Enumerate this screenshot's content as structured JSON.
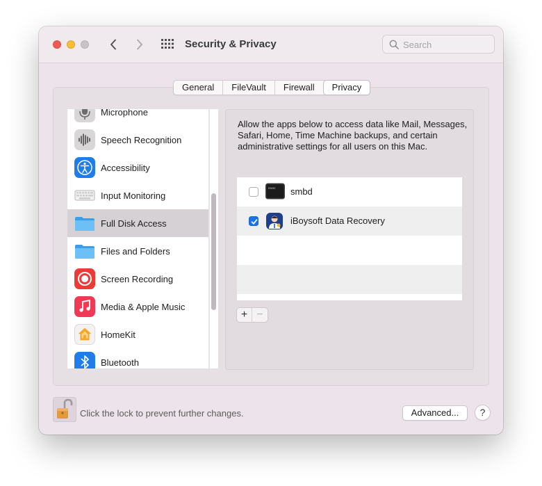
{
  "window": {
    "title": "Security & Privacy",
    "search": {
      "placeholder": "Search",
      "value": ""
    }
  },
  "tabs": [
    {
      "label": "General"
    },
    {
      "label": "FileVault"
    },
    {
      "label": "Firewall"
    },
    {
      "label": "Privacy",
      "active": true
    }
  ],
  "privacy_list": [
    {
      "label": "Microphone",
      "icon": "microphone-icon"
    },
    {
      "label": "Speech Recognition",
      "icon": "waveform-icon"
    },
    {
      "label": "Accessibility",
      "icon": "accessibility-icon"
    },
    {
      "label": "Input Monitoring",
      "icon": "keyboard-icon"
    },
    {
      "label": "Full Disk Access",
      "icon": "folder-icon",
      "selected": true
    },
    {
      "label": "Files and Folders",
      "icon": "folder-icon"
    },
    {
      "label": "Screen Recording",
      "icon": "record-icon"
    },
    {
      "label": "Media & Apple Music",
      "icon": "music-icon"
    },
    {
      "label": "HomeKit",
      "icon": "home-icon"
    },
    {
      "label": "Bluetooth",
      "icon": "bluetooth-icon"
    }
  ],
  "detail": {
    "description": "Allow the apps below to access data like Mail, Messages, Safari, Home, Time Machine backups, and certain administrative settings for all users on this Mac.",
    "apps": [
      {
        "name": "smbd",
        "checked": false,
        "icon": "terminal-icon"
      },
      {
        "name": "iBoysoft Data Recovery",
        "checked": true,
        "icon": "iboysoft-icon"
      }
    ],
    "add_label": "+",
    "remove_label": "−"
  },
  "footer": {
    "lock_text": "Click the lock to prevent further changes.",
    "advanced_label": "Advanced...",
    "help_label": "?"
  },
  "colors": {
    "window_bg": "#ece4ea",
    "accent_blue": "#1a73e8",
    "selection_gray": "#d6d1d4"
  }
}
